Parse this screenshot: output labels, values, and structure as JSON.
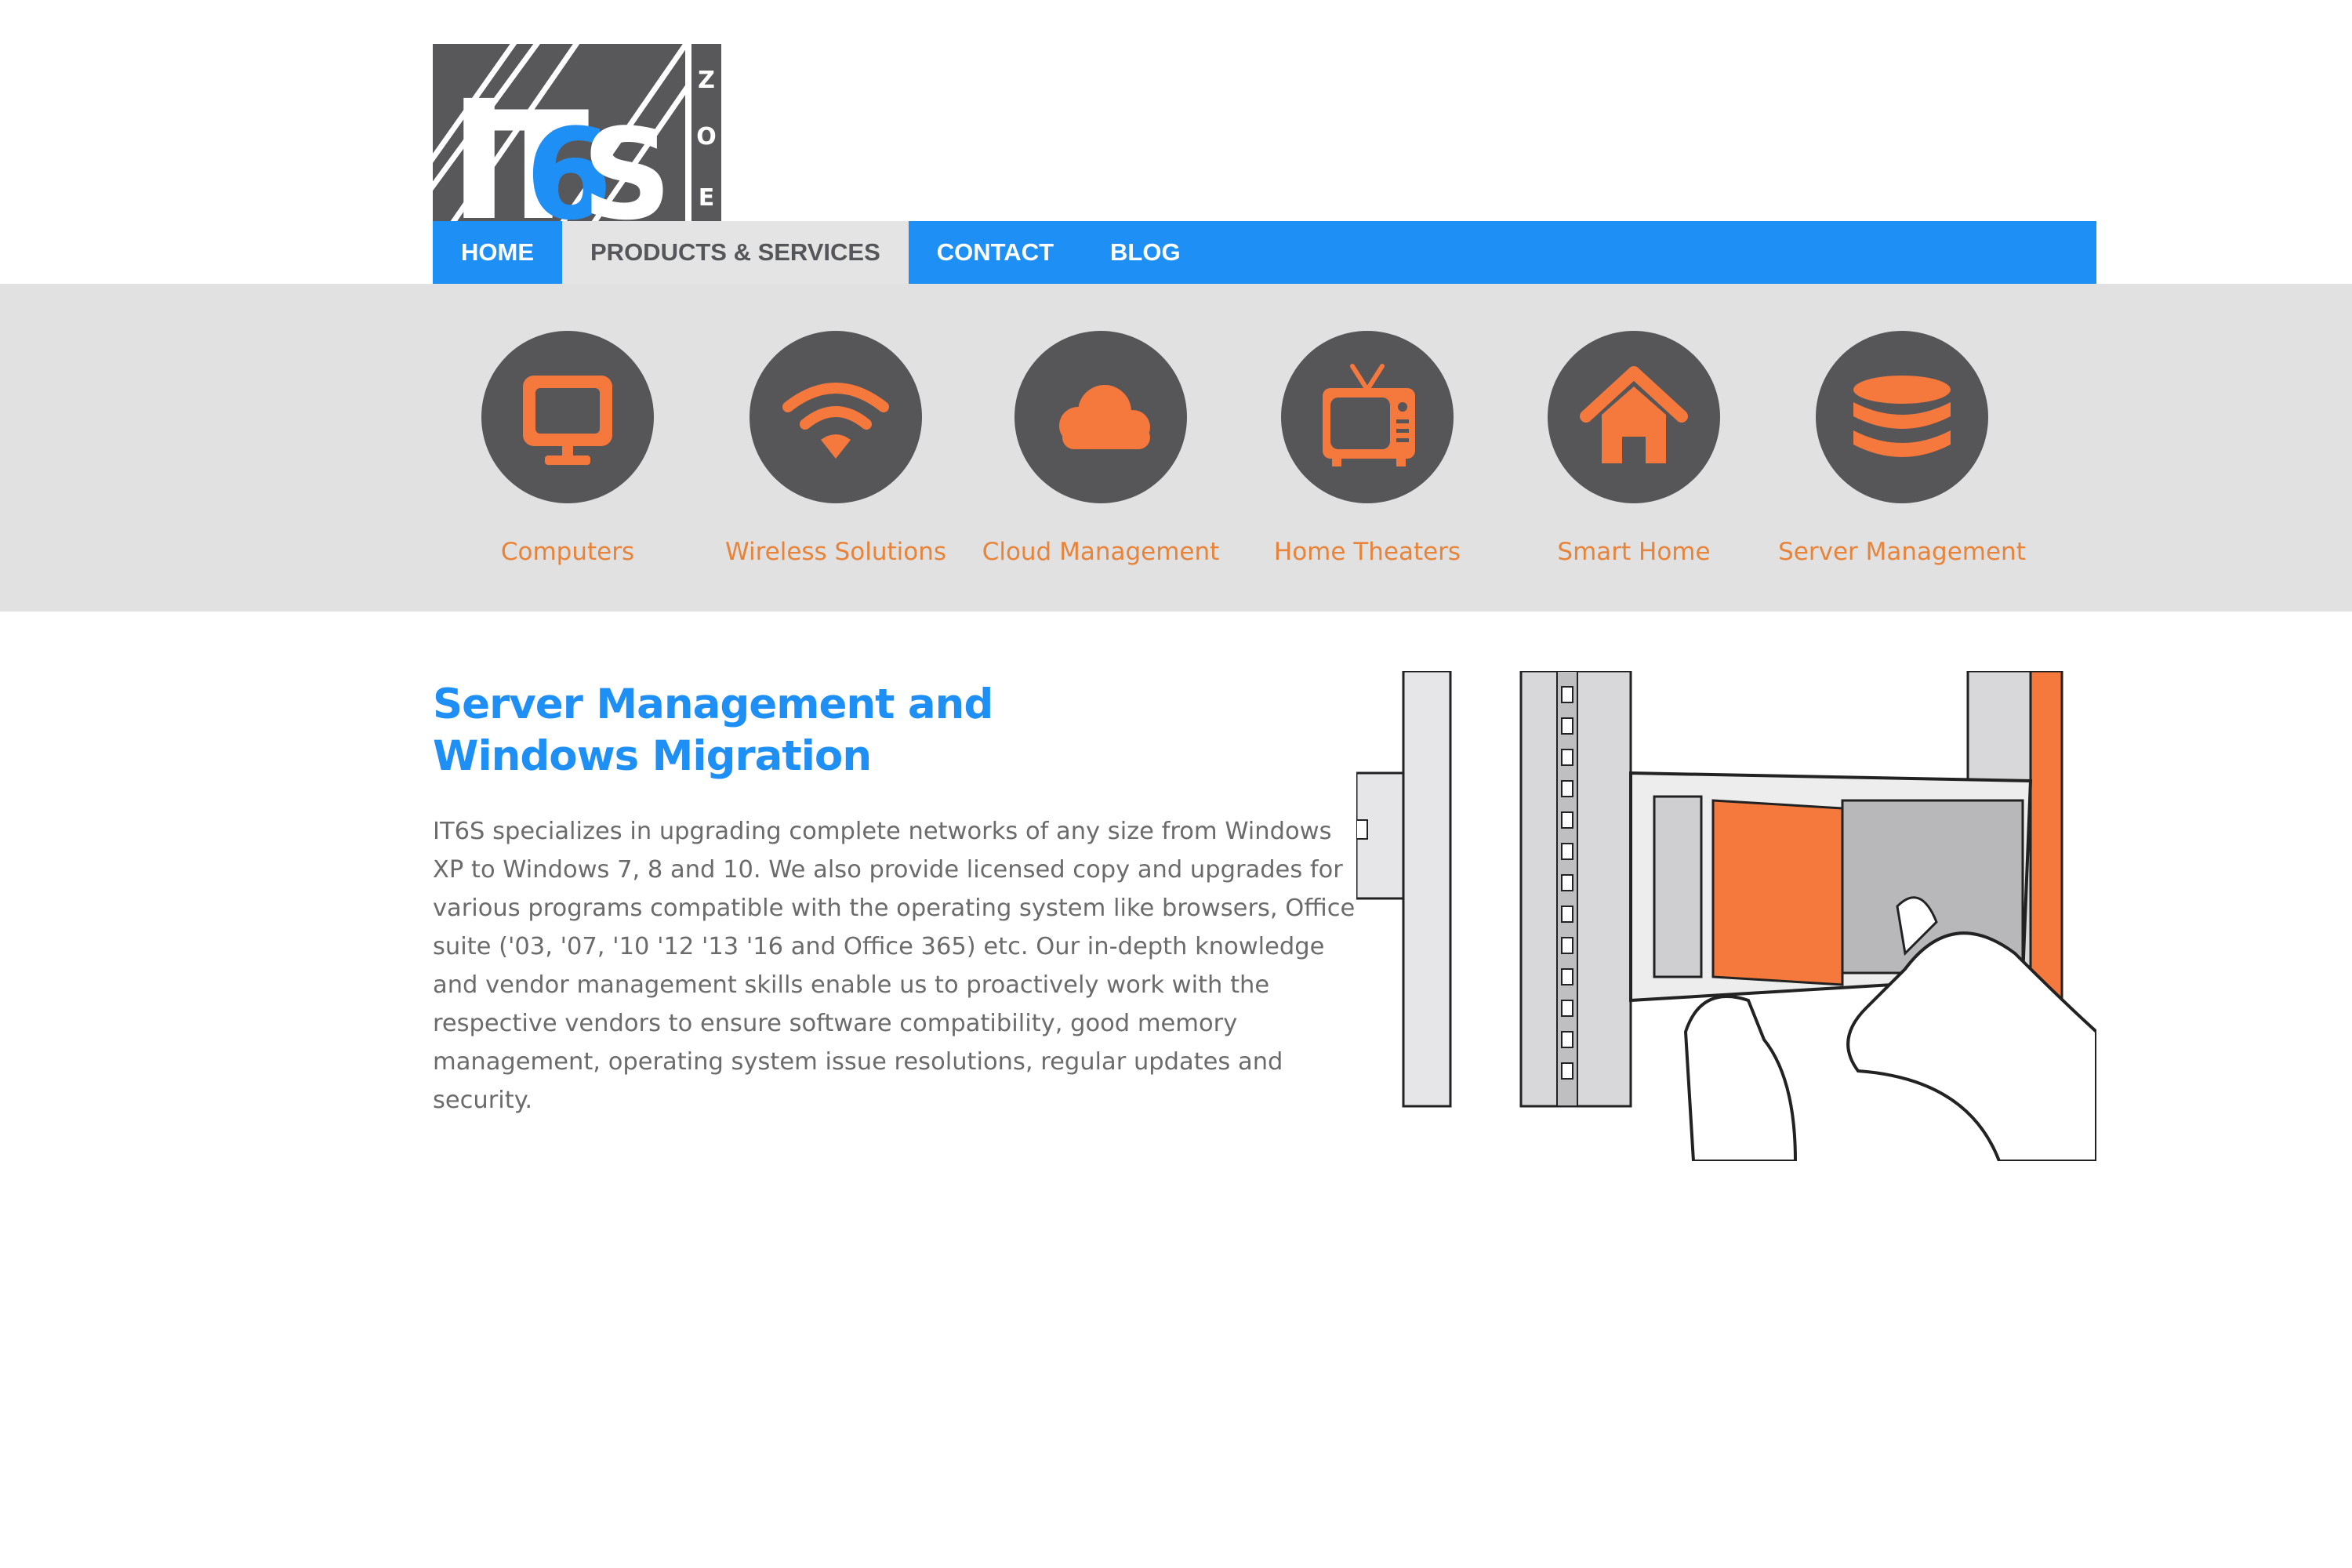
{
  "logo": {
    "letters": "IT6S",
    "side_text": "ZOE"
  },
  "nav": {
    "items": [
      {
        "label": "HOME",
        "active": false
      },
      {
        "label": "PRODUCTS & SERVICES",
        "active": true
      },
      {
        "label": "CONTACT",
        "active": false
      },
      {
        "label": "BLOG",
        "active": false
      }
    ]
  },
  "services": [
    {
      "label": "Computers",
      "icon": "monitor-icon"
    },
    {
      "label": "Wireless Solutions",
      "icon": "wifi-icon"
    },
    {
      "label": "Cloud Management",
      "icon": "cloud-icon"
    },
    {
      "label": "Home Theaters",
      "icon": "tv-icon"
    },
    {
      "label": "Smart Home",
      "icon": "home-icon"
    },
    {
      "label": "Server Management",
      "icon": "database-icon"
    }
  ],
  "main": {
    "title_line1": "Server Management and",
    "title_line2": "Windows Migration",
    "body": "IT6S specializes in upgrading complete networks of any size from Windows XP to Windows 7, 8 and 10. We also provide licensed copy and upgrades for various programs compatible with the operating system like browsers, Office suite ('03, '07, '10 '12 '13 '16 and Office 365) etc. Our in-depth knowledge and vendor management skills enable us to proactively work with the respective vendors to ensure software compatibility, good memory management, operating system issue resolutions, regular updates and security."
  },
  "colors": {
    "brand_blue": "#1e8ff5",
    "accent_orange": "#f5783c",
    "icon_circle": "#565558",
    "band_gray": "#e1e1e1",
    "text_gray": "#6b6b6b"
  }
}
